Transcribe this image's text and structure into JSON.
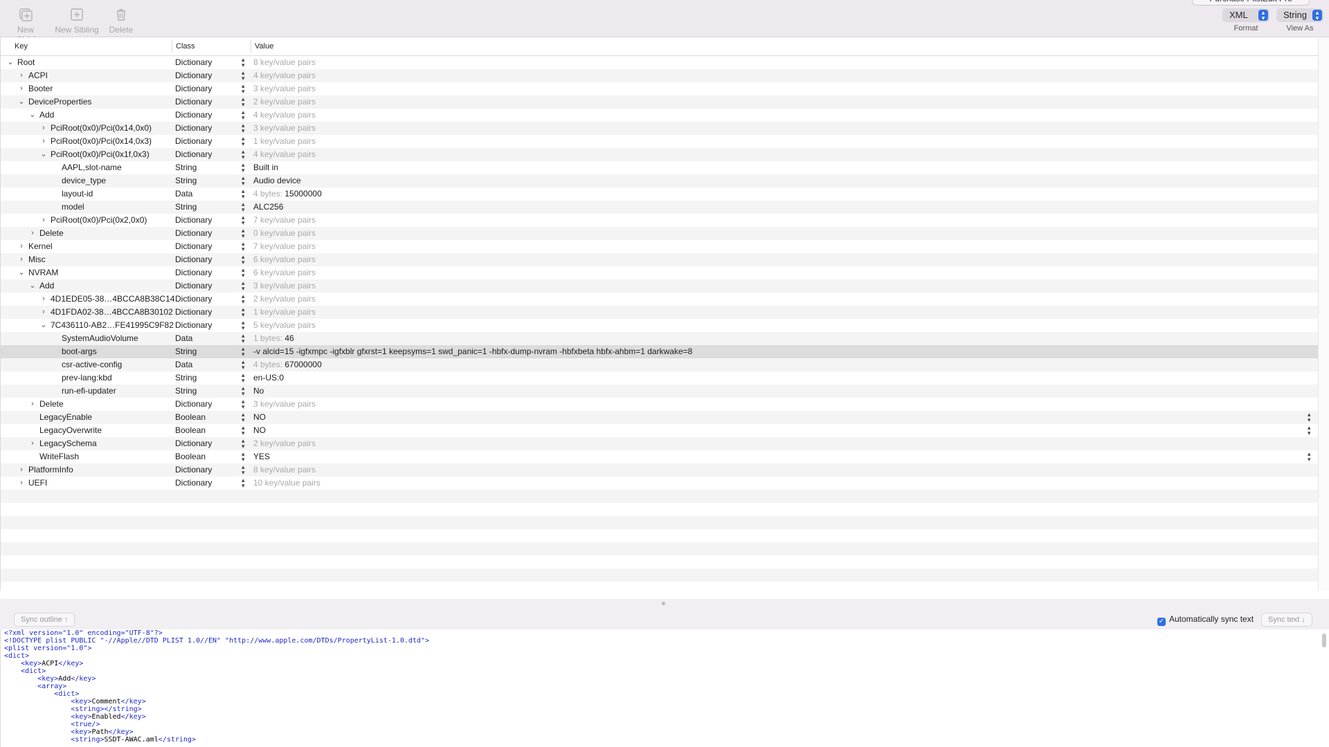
{
  "toolbar": {
    "new_child": "New Child",
    "new_sibling": "New Sibling",
    "delete": "Delete",
    "purchase": "Purchase PlistEdit Pro",
    "format_value": "XML",
    "format_label": "Format",
    "viewas_value": "String",
    "viewas_label": "View As"
  },
  "columns": {
    "key": "Key",
    "class": "Class",
    "value": "Value"
  },
  "rows": [
    {
      "key": "Root",
      "class": "Dictionary",
      "value": "8 key/value pairs",
      "indent": 0,
      "disc": "open",
      "muted": true
    },
    {
      "key": "ACPI",
      "class": "Dictionary",
      "value": "4 key/value pairs",
      "indent": 1,
      "disc": "closed",
      "muted": true
    },
    {
      "key": "Booter",
      "class": "Dictionary",
      "value": "3 key/value pairs",
      "indent": 1,
      "disc": "closed",
      "muted": true
    },
    {
      "key": "DeviceProperties",
      "class": "Dictionary",
      "value": "2 key/value pairs",
      "indent": 1,
      "disc": "open",
      "muted": true
    },
    {
      "key": "Add",
      "class": "Dictionary",
      "value": "4 key/value pairs",
      "indent": 2,
      "disc": "open",
      "muted": true
    },
    {
      "key": "PciRoot(0x0)/Pci(0x14,0x0)",
      "class": "Dictionary",
      "value": "3 key/value pairs",
      "indent": 3,
      "disc": "closed",
      "muted": true
    },
    {
      "key": "PciRoot(0x0)/Pci(0x14,0x3)",
      "class": "Dictionary",
      "value": "1 key/value pairs",
      "indent": 3,
      "disc": "closed",
      "muted": true
    },
    {
      "key": "PciRoot(0x0)/Pci(0x1f,0x3)",
      "class": "Dictionary",
      "value": "4 key/value pairs",
      "indent": 3,
      "disc": "open",
      "muted": true
    },
    {
      "key": "AAPL,slot-name",
      "class": "String",
      "value": "Built in",
      "indent": 4,
      "disc": "none",
      "muted": false
    },
    {
      "key": "device_type",
      "class": "String",
      "value": "Audio device",
      "indent": 4,
      "disc": "none",
      "muted": false
    },
    {
      "key": "layout-id",
      "class": "Data",
      "value_prefix": "4 bytes: ",
      "value": "15000000",
      "indent": 4,
      "disc": "none",
      "muted": false
    },
    {
      "key": "model",
      "class": "String",
      "value": "ALC256",
      "indent": 4,
      "disc": "none",
      "muted": false
    },
    {
      "key": "PciRoot(0x0)/Pci(0x2,0x0)",
      "class": "Dictionary",
      "value": "7 key/value pairs",
      "indent": 3,
      "disc": "closed",
      "muted": true
    },
    {
      "key": "Delete",
      "class": "Dictionary",
      "value": "0 key/value pairs",
      "indent": 2,
      "disc": "closed",
      "muted": true
    },
    {
      "key": "Kernel",
      "class": "Dictionary",
      "value": "7 key/value pairs",
      "indent": 1,
      "disc": "closed",
      "muted": true
    },
    {
      "key": "Misc",
      "class": "Dictionary",
      "value": "6 key/value pairs",
      "indent": 1,
      "disc": "closed",
      "muted": true
    },
    {
      "key": "NVRAM",
      "class": "Dictionary",
      "value": "6 key/value pairs",
      "indent": 1,
      "disc": "open",
      "muted": true
    },
    {
      "key": "Add",
      "class": "Dictionary",
      "value": "3 key/value pairs",
      "indent": 2,
      "disc": "open",
      "muted": true
    },
    {
      "key": "4D1EDE05-38…4BCCA8B38C14",
      "class": "Dictionary",
      "value": "2 key/value pairs",
      "indent": 3,
      "disc": "closed",
      "muted": true
    },
    {
      "key": "4D1FDA02-38…4BCCA8B30102",
      "class": "Dictionary",
      "value": "1 key/value pairs",
      "indent": 3,
      "disc": "closed",
      "muted": true
    },
    {
      "key": "7C436110-AB2…FE41995C9F82",
      "class": "Dictionary",
      "value": "5 key/value pairs",
      "indent": 3,
      "disc": "open",
      "muted": true
    },
    {
      "key": "SystemAudioVolume",
      "class": "Data",
      "value_prefix": "1 bytes: ",
      "value": "46",
      "indent": 4,
      "disc": "none",
      "muted": false
    },
    {
      "key": "boot-args",
      "class": "String",
      "value": "-v alcid=15 -igfxmpc -igfxblr gfxrst=1 keepsyms=1 swd_panic=1 -hbfx-dump-nvram -hbfxbeta hbfx-ahbm=1 darkwake=8",
      "indent": 4,
      "disc": "none",
      "muted": false,
      "selected": true
    },
    {
      "key": "csr-active-config",
      "class": "Data",
      "value_prefix": "4 bytes: ",
      "value": "67000000",
      "indent": 4,
      "disc": "none",
      "muted": false
    },
    {
      "key": "prev-lang:kbd",
      "class": "String",
      "value": "en-US:0",
      "indent": 4,
      "disc": "none",
      "muted": false
    },
    {
      "key": "run-efi-updater",
      "class": "String",
      "value": "No",
      "indent": 4,
      "disc": "none",
      "muted": false
    },
    {
      "key": "Delete",
      "class": "Dictionary",
      "value": "3 key/value pairs",
      "indent": 2,
      "disc": "closed",
      "muted": true
    },
    {
      "key": "LegacyEnable",
      "class": "Boolean",
      "value": "NO",
      "indent": 2,
      "disc": "none",
      "muted": false,
      "popup": true
    },
    {
      "key": "LegacyOverwrite",
      "class": "Boolean",
      "value": "NO",
      "indent": 2,
      "disc": "none",
      "muted": false,
      "popup": true
    },
    {
      "key": "LegacySchema",
      "class": "Dictionary",
      "value": "2 key/value pairs",
      "indent": 2,
      "disc": "closed",
      "muted": true
    },
    {
      "key": "WriteFlash",
      "class": "Boolean",
      "value": "YES",
      "indent": 2,
      "disc": "none",
      "muted": false,
      "popup": true
    },
    {
      "key": "PlatformInfo",
      "class": "Dictionary",
      "value": "8 key/value pairs",
      "indent": 1,
      "disc": "closed",
      "muted": true
    },
    {
      "key": "UEFI",
      "class": "Dictionary",
      "value": "10 key/value pairs",
      "indent": 1,
      "disc": "closed",
      "muted": true
    }
  ],
  "bottombar": {
    "sync_outline": "Sync outline ↑",
    "auto_sync": "Automatically sync text",
    "auto_sync_checked": true,
    "sync_text": "Sync text ↓"
  },
  "text_lines": [
    [
      {
        "t": "tag",
        "v": "<?xml version=\"1.0\" encoding=\"UTF-8\"?>"
      }
    ],
    [
      {
        "t": "tag",
        "v": "<!DOCTYPE plist PUBLIC \"-//Apple//DTD PLIST 1.0//EN\" \"http://www.apple.com/DTDs/PropertyList-1.0.dtd\">"
      }
    ],
    [
      {
        "t": "tag",
        "v": "<plist version=\"1.0\">"
      }
    ],
    [
      {
        "t": "tag",
        "v": "<dict>"
      }
    ],
    [
      {
        "t": "txt",
        "v": "    "
      },
      {
        "t": "tag",
        "v": "<key>"
      },
      {
        "t": "txt",
        "v": "ACPI"
      },
      {
        "t": "tag",
        "v": "</key>"
      }
    ],
    [
      {
        "t": "txt",
        "v": "    "
      },
      {
        "t": "tag",
        "v": "<dict>"
      }
    ],
    [
      {
        "t": "txt",
        "v": "        "
      },
      {
        "t": "tag",
        "v": "<key>"
      },
      {
        "t": "txt",
        "v": "Add"
      },
      {
        "t": "tag",
        "v": "</key>"
      }
    ],
    [
      {
        "t": "txt",
        "v": "        "
      },
      {
        "t": "tag",
        "v": "<array>"
      }
    ],
    [
      {
        "t": "txt",
        "v": "            "
      },
      {
        "t": "tag",
        "v": "<dict>"
      }
    ],
    [
      {
        "t": "txt",
        "v": "                "
      },
      {
        "t": "tag",
        "v": "<key>"
      },
      {
        "t": "txt",
        "v": "Comment"
      },
      {
        "t": "tag",
        "v": "</key>"
      }
    ],
    [
      {
        "t": "txt",
        "v": "                "
      },
      {
        "t": "tag",
        "v": "<string></string>"
      }
    ],
    [
      {
        "t": "txt",
        "v": "                "
      },
      {
        "t": "tag",
        "v": "<key>"
      },
      {
        "t": "txt",
        "v": "Enabled"
      },
      {
        "t": "tag",
        "v": "</key>"
      }
    ],
    [
      {
        "t": "txt",
        "v": "                "
      },
      {
        "t": "tag",
        "v": "<true/>"
      }
    ],
    [
      {
        "t": "txt",
        "v": "                "
      },
      {
        "t": "tag",
        "v": "<key>"
      },
      {
        "t": "txt",
        "v": "Path"
      },
      {
        "t": "tag",
        "v": "</key>"
      }
    ],
    [
      {
        "t": "txt",
        "v": "                "
      },
      {
        "t": "tag",
        "v": "<string>"
      },
      {
        "t": "txt",
        "v": "SSDT-AWAC.aml"
      },
      {
        "t": "tag",
        "v": "</string>"
      }
    ]
  ]
}
